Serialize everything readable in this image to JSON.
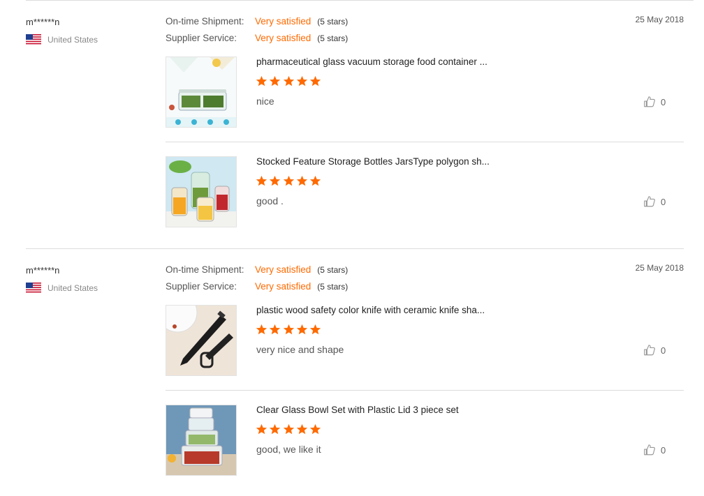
{
  "reviews": [
    {
      "buyer": "m******n",
      "country": "United States",
      "date": "25 May 2018",
      "shipment_label": "On-time Shipment:",
      "shipment_value": "Very satisfied",
      "shipment_stars": "(5 stars)",
      "service_label": "Supplier Service:",
      "service_value": "Very satisfied",
      "service_stars": "(5 stars)",
      "products": [
        {
          "title": "pharmaceutical glass vacuum storage food container ...",
          "rating": 5,
          "comment": "nice",
          "likes": "0"
        },
        {
          "title": "Stocked Feature Storage Bottles JarsType polygon sh...",
          "rating": 5,
          "comment": "good .",
          "likes": "0"
        }
      ]
    },
    {
      "buyer": "m******n",
      "country": "United States",
      "date": "25 May 2018",
      "shipment_label": "On-time Shipment:",
      "shipment_value": "Very satisfied",
      "shipment_stars": "(5 stars)",
      "service_label": "Supplier Service:",
      "service_value": "Very satisfied",
      "service_stars": "(5 stars)",
      "products": [
        {
          "title": "plastic wood safety color knife with ceramic knife sha...",
          "rating": 5,
          "comment": "very nice and shape",
          "likes": "0"
        },
        {
          "title": "Clear Glass Bowl Set with Plastic Lid 3 piece set",
          "rating": 5,
          "comment": "good, we like it",
          "likes": "0"
        }
      ]
    }
  ],
  "colors": {
    "accent": "#ff6a00",
    "star": "#ff6a00",
    "divider": "#dcdcdc"
  },
  "icons": {
    "like": "thumbs-up-icon",
    "flag": "us-flag-icon"
  }
}
